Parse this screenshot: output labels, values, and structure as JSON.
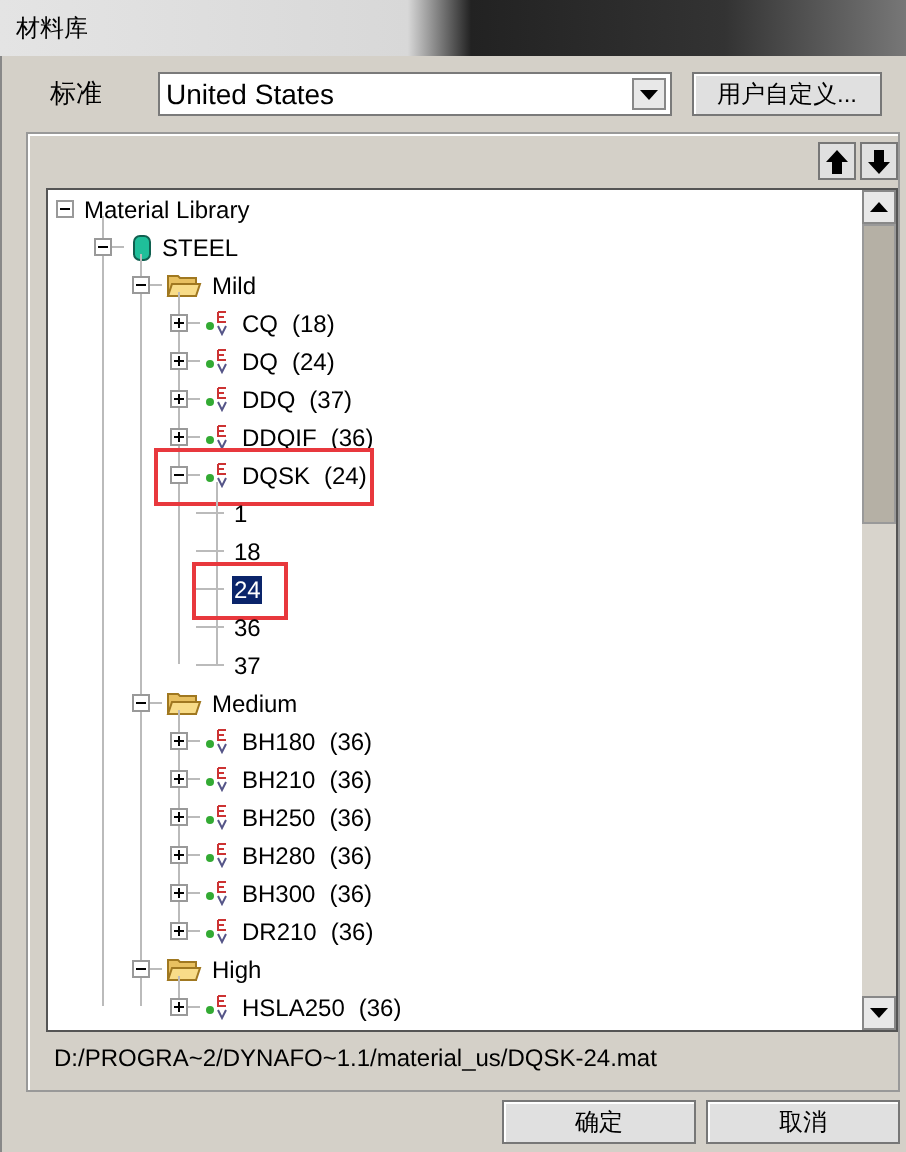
{
  "window": {
    "title": "材料库"
  },
  "standard": {
    "label": "标准",
    "value": "United States"
  },
  "custom_button": "用户自定义...",
  "tree": [
    {
      "kind": "root",
      "label": "Material Library",
      "expanded": true,
      "children": [
        {
          "kind": "database",
          "label": "STEEL",
          "expanded": true,
          "children": [
            {
              "kind": "folder",
              "label": "Mild",
              "expanded": true,
              "children": [
                {
                  "kind": "material",
                  "label": "CQ",
                  "count": "(18)",
                  "expanded": false
                },
                {
                  "kind": "material",
                  "label": "DQ",
                  "count": "(24)",
                  "expanded": false
                },
                {
                  "kind": "material",
                  "label": "DDQ",
                  "count": "(37)",
                  "expanded": false
                },
                {
                  "kind": "material",
                  "label": "DDQIF",
                  "count": "(36)",
                  "expanded": false
                },
                {
                  "kind": "material",
                  "label": "DQSK",
                  "count": "(24)",
                  "expanded": true,
                  "highlighted": true,
                  "children": [
                    {
                      "kind": "leaf",
                      "label": "1",
                      "selected": false,
                      "highlighted": false
                    },
                    {
                      "kind": "leaf",
                      "label": "18",
                      "selected": false,
                      "highlighted": false
                    },
                    {
                      "kind": "leaf",
                      "label": "24",
                      "selected": true,
                      "highlighted": true
                    },
                    {
                      "kind": "leaf",
                      "label": "36",
                      "selected": false,
                      "highlighted": false
                    },
                    {
                      "kind": "leaf",
                      "label": "37",
                      "selected": false,
                      "highlighted": false
                    }
                  ]
                }
              ]
            },
            {
              "kind": "folder",
              "label": "Medium",
              "expanded": true,
              "children": [
                {
                  "kind": "material",
                  "label": "BH180",
                  "count": "(36)",
                  "expanded": false
                },
                {
                  "kind": "material",
                  "label": "BH210",
                  "count": "(36)",
                  "expanded": false
                },
                {
                  "kind": "material",
                  "label": "BH250",
                  "count": "(36)",
                  "expanded": false
                },
                {
                  "kind": "material",
                  "label": "BH280",
                  "count": "(36)",
                  "expanded": false
                },
                {
                  "kind": "material",
                  "label": "BH300",
                  "count": "(36)",
                  "expanded": false
                },
                {
                  "kind": "material",
                  "label": "DR210",
                  "count": "(36)",
                  "expanded": false
                }
              ]
            },
            {
              "kind": "folder",
              "label": "High",
              "expanded": true,
              "children": [
                {
                  "kind": "material",
                  "label": "HSLA250",
                  "count": "(36)",
                  "expanded": false
                }
              ]
            }
          ]
        }
      ]
    }
  ],
  "path": "D:/PROGRA~2/DYNAFO~1.1/material_us/DQSK-24.mat",
  "buttons": [
    {
      "label": "确定"
    },
    {
      "label": "取消"
    }
  ]
}
